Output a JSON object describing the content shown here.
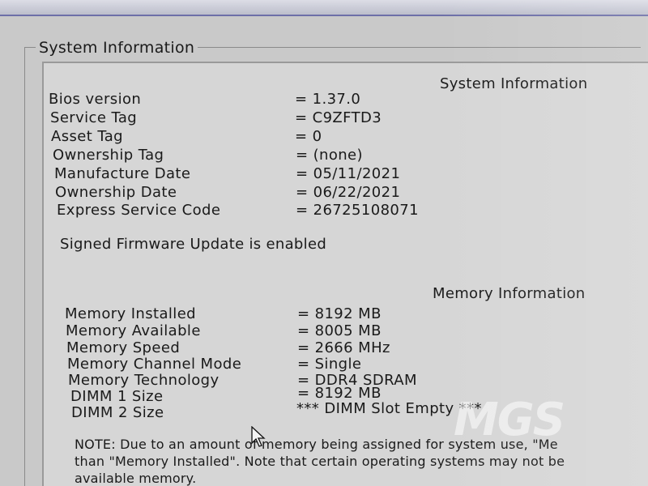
{
  "group_title": "System Information",
  "system_info": {
    "heading": "System Information",
    "rows": [
      {
        "label": "Bios version",
        "value": "= 1.37.0"
      },
      {
        "label": "Service Tag",
        "value": "= C9ZFTD3"
      },
      {
        "label": "Asset Tag",
        "value": "= 0"
      },
      {
        "label": "Ownership Tag",
        "value": "= (none)"
      },
      {
        "label": "Manufacture Date",
        "value": "= 05/11/2021"
      },
      {
        "label": "Ownership Date",
        "value": "= 06/22/2021"
      },
      {
        "label": "Express Service Code",
        "value": "= 26725108071"
      }
    ],
    "firmware_notice": "Signed Firmware Update is enabled"
  },
  "memory_info": {
    "heading": "Memory Information",
    "rows": [
      {
        "label": "Memory Installed",
        "value": "= 8192 MB"
      },
      {
        "label": "Memory Available",
        "value": "= 8005 MB"
      },
      {
        "label": "Memory Speed",
        "value": "= 2666 MHz"
      },
      {
        "label": "Memory Channel Mode",
        "value": "= Single"
      },
      {
        "label": "Memory Technology",
        "value": "= DDR4 SDRAM"
      },
      {
        "label": "DIMM 1 Size",
        "value": "= 8192 MB"
      },
      {
        "label": "DIMM 2 Size",
        "value": "*** DIMM Slot Empty ***"
      }
    ]
  },
  "note": {
    "line1": "NOTE: Due to an amount of memory being assigned for system use, \"Me",
    "line2": "than \"Memory Installed\". Note that certain operating systems may not be",
    "line3": "available memory."
  },
  "watermark": "MGS",
  "colors": {
    "background": "#c9c9c9",
    "panel": "#d6d6d6",
    "text": "#1a1a1a",
    "top_band_border": "#6d6fa8"
  }
}
